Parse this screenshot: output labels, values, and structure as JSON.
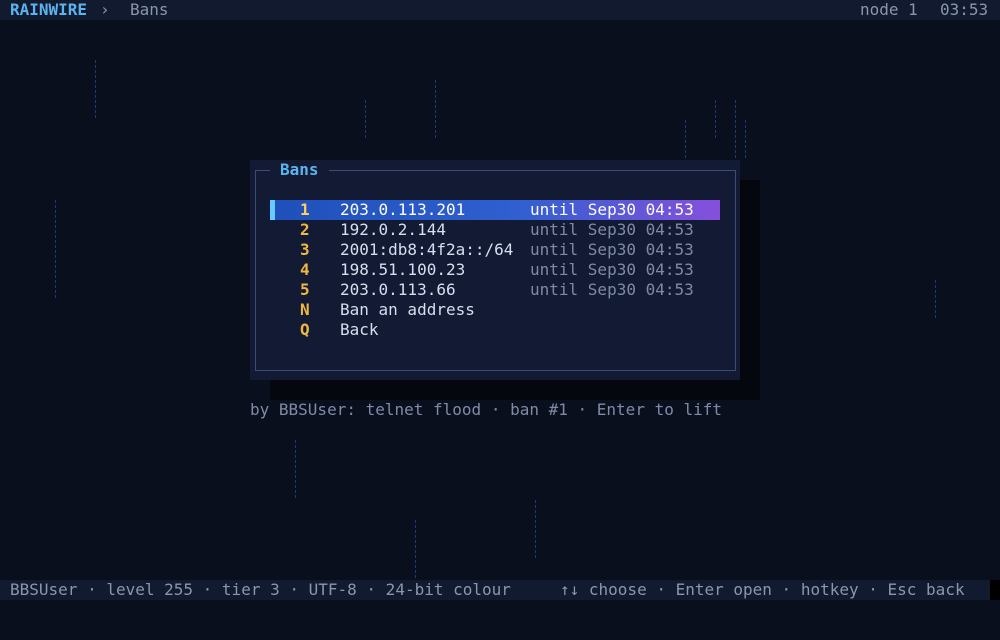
{
  "header": {
    "brand": "RAINWIRE",
    "separator": "›",
    "breadcrumb": "Bans",
    "node": "node 1",
    "clock": "03:53"
  },
  "dialog": {
    "title": "Bans",
    "bans": [
      {
        "hotkey": "1",
        "address": "203.0.113.201",
        "until": "until Sep30 04:53"
      },
      {
        "hotkey": "2",
        "address": "192.0.2.144",
        "until": "until Sep30 04:53"
      },
      {
        "hotkey": "3",
        "address": "2001:db8:4f2a::/64",
        "until": "until Sep30 04:53"
      },
      {
        "hotkey": "4",
        "address": "198.51.100.23",
        "until": "until Sep30 04:53"
      },
      {
        "hotkey": "5",
        "address": "203.0.113.66",
        "until": "until Sep30 04:53"
      }
    ],
    "actions": [
      {
        "hotkey": "N",
        "label": "Ban an address"
      },
      {
        "hotkey": "Q",
        "label": "Back"
      }
    ]
  },
  "hint": "by BBSUser: telnet flood · ban #1 · Enter to lift",
  "status": {
    "left": "BBSUser · level 255 · tier 3 · UTF-8 · 24-bit colour",
    "right": "↑↓ choose · Enter open · hotkey · Esc back"
  }
}
